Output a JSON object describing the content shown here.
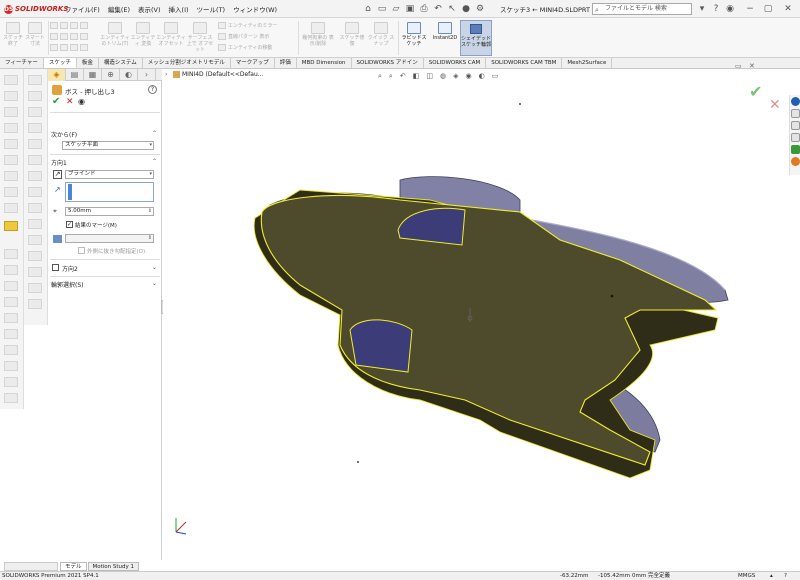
{
  "app": {
    "logo_text": "SOLIDWORKS",
    "title": "スケッチ3 ← MINI4D.SLDPRT *"
  },
  "menu": [
    "ファイル(F)",
    "編集(E)",
    "表示(V)",
    "挿入(I)",
    "ツール(T)",
    "ウィンドウ(W)"
  ],
  "search": {
    "placeholder": "ファイルとモデル 検索"
  },
  "command_manager": {
    "groups": [
      {
        "label": "スケッチ 終了"
      },
      {
        "label": "スマート 寸法"
      },
      {
        "label": "エンティティ のトリム(T)"
      },
      {
        "label": "エンティティ 変換"
      },
      {
        "label": "エンティティ オフセット"
      },
      {
        "label": "サーフェス 上で オフセット"
      },
      {
        "label": "幾何拘束の 表示/削除"
      },
      {
        "label": "スケッチ修復"
      },
      {
        "label": "クイック スナップ"
      },
      {
        "label": "ラピッドスケッチ"
      },
      {
        "label": "Instant2D"
      },
      {
        "label": "シェイデッド スケッチ輪郭"
      }
    ],
    "small_items": [
      "エンティティのミラー",
      "直線パターン 表示",
      "エンティティの移動"
    ]
  },
  "tabs": [
    "フィーチャー",
    "スケッチ",
    "板金",
    "構造システム",
    "メッシュ分割ジオメトリモデル",
    "マークアップ",
    "評価",
    "MBD Dimension",
    "SOLIDWORKS アドイン",
    "SOLIDWORKS CAM",
    "SOLIDWORKS CAM TBM",
    "Mesh2Surface"
  ],
  "active_tab": "スケッチ",
  "property_manager": {
    "title": "ボス - 押し出し3",
    "from_section": "次から(F)",
    "from_value": "スケッチ平面",
    "dir1_section": "方向1",
    "dir1_type": "ブラインド",
    "depth": "5.00mm",
    "merge_label": "結果のマージ(M)",
    "draft_outward": "外側に抜き勾配指定(O)",
    "dir2_section": "方向2",
    "contour_section": "輪郭選択(S)"
  },
  "viewport": {
    "breadcrumb": "MINI4D (Default<<Defau...",
    "model_color": "#4e4a2c",
    "edge_color": "#f2ee2a",
    "wheel_color": "#7c7c9e"
  },
  "bottom_tabs": [
    "モデル",
    "Motion Study 1"
  ],
  "status": {
    "left": "SOLIDWORKS Premium 2021 SP4.1",
    "x": "-63.22mm",
    "y": "-105.42mm",
    "z": "0mm 完全定義",
    "units": "MMGS"
  }
}
